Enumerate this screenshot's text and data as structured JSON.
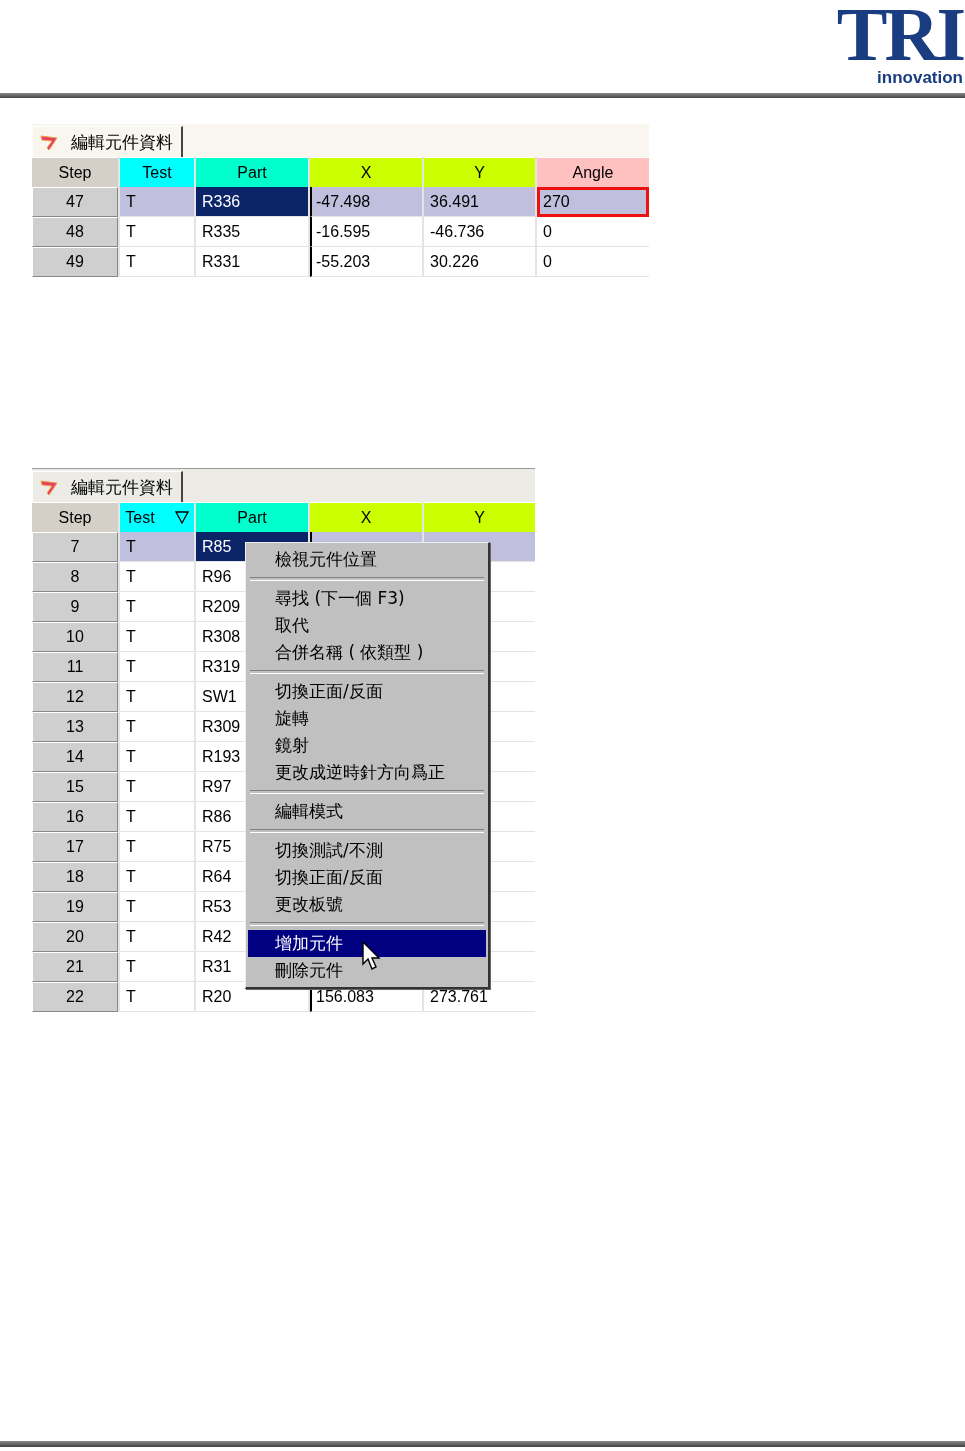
{
  "logo": {
    "title": "TRI",
    "subtitle": "innovation"
  },
  "panels": [
    {
      "tab_title": "編輯元件資料",
      "columns": [
        {
          "label": "Step",
          "color": "#d4d0c8",
          "sort_indicator": false
        },
        {
          "label": "Test",
          "color": "#00ffff",
          "sort_indicator": false
        },
        {
          "label": "Part",
          "color": "#00ffcc",
          "sort_indicator": false
        },
        {
          "label": "X",
          "color": "#ccff00",
          "sort_indicator": false
        },
        {
          "label": "Y",
          "color": "#ccff00",
          "sort_indicator": false
        },
        {
          "label": "Angle",
          "color": "#ffc0c0",
          "sort_indicator": false
        }
      ],
      "rows": [
        {
          "selected": true,
          "cells": [
            {
              "text": "47",
              "selected": false,
              "outlined": false
            },
            {
              "text": "T",
              "selected": false,
              "outlined": false
            },
            {
              "text": "R336",
              "selected": true,
              "outlined": false
            },
            {
              "text": "-47.498",
              "selected": false,
              "outlined": false
            },
            {
              "text": "36.491",
              "selected": false,
              "outlined": false
            },
            {
              "text": "270",
              "selected": false,
              "outlined": true
            }
          ]
        },
        {
          "selected": false,
          "cells": [
            {
              "text": "48",
              "selected": false,
              "outlined": false
            },
            {
              "text": "T",
              "selected": false,
              "outlined": false
            },
            {
              "text": "R335",
              "selected": false,
              "outlined": false
            },
            {
              "text": "-16.595",
              "selected": false,
              "outlined": false
            },
            {
              "text": "-46.736",
              "selected": false,
              "outlined": false
            },
            {
              "text": "0",
              "selected": false,
              "outlined": false
            }
          ]
        },
        {
          "selected": false,
          "cells": [
            {
              "text": "49",
              "selected": false,
              "outlined": false
            },
            {
              "text": "T",
              "selected": false,
              "outlined": false
            },
            {
              "text": "R331",
              "selected": false,
              "outlined": false
            },
            {
              "text": "-55.203",
              "selected": false,
              "outlined": false
            },
            {
              "text": "30.226",
              "selected": false,
              "outlined": false
            },
            {
              "text": "0",
              "selected": false,
              "outlined": false
            }
          ]
        }
      ]
    },
    {
      "tab_title": "編輯元件資料",
      "columns": [
        {
          "label": "Step",
          "color": "#d4d0c8",
          "sort_indicator": false
        },
        {
          "label": "Test",
          "color": "#00ffff",
          "sort_indicator": true
        },
        {
          "label": "Part",
          "color": "#00ffcc",
          "sort_indicator": false
        },
        {
          "label": "X",
          "color": "#ccff00",
          "sort_indicator": false
        },
        {
          "label": "Y",
          "color": "#ccff00",
          "sort_indicator": false
        }
      ],
      "rows": [
        {
          "selected": true,
          "cells": [
            {
              "text": "7",
              "selected": false
            },
            {
              "text": "T",
              "selected": false
            },
            {
              "text": "R85",
              "selected": true
            }
          ]
        },
        {
          "selected": false,
          "cells": [
            {
              "text": "8",
              "selected": false
            },
            {
              "text": "T",
              "selected": false
            },
            {
              "text": "R96",
              "selected": false
            }
          ]
        },
        {
          "selected": false,
          "cells": [
            {
              "text": "9",
              "selected": false
            },
            {
              "text": "T",
              "selected": false
            },
            {
              "text": "R209",
              "selected": false
            }
          ]
        },
        {
          "selected": false,
          "cells": [
            {
              "text": "10",
              "selected": false
            },
            {
              "text": "T",
              "selected": false
            },
            {
              "text": "R308",
              "selected": false
            }
          ]
        },
        {
          "selected": false,
          "cells": [
            {
              "text": "11",
              "selected": false
            },
            {
              "text": "T",
              "selected": false
            },
            {
              "text": "R319",
              "selected": false
            }
          ]
        },
        {
          "selected": false,
          "cells": [
            {
              "text": "12",
              "selected": false
            },
            {
              "text": "T",
              "selected": false
            },
            {
              "text": "SW1",
              "selected": false
            }
          ]
        },
        {
          "selected": false,
          "cells": [
            {
              "text": "13",
              "selected": false
            },
            {
              "text": "T",
              "selected": false
            },
            {
              "text": "R309",
              "selected": false
            }
          ]
        },
        {
          "selected": false,
          "cells": [
            {
              "text": "14",
              "selected": false
            },
            {
              "text": "T",
              "selected": false
            },
            {
              "text": "R193",
              "selected": false
            }
          ]
        },
        {
          "selected": false,
          "cells": [
            {
              "text": "15",
              "selected": false
            },
            {
              "text": "T",
              "selected": false
            },
            {
              "text": "R97",
              "selected": false
            }
          ]
        },
        {
          "selected": false,
          "cells": [
            {
              "text": "16",
              "selected": false
            },
            {
              "text": "T",
              "selected": false
            },
            {
              "text": "R86",
              "selected": false
            }
          ]
        },
        {
          "selected": false,
          "cells": [
            {
              "text": "17",
              "selected": false
            },
            {
              "text": "T",
              "selected": false
            },
            {
              "text": "R75",
              "selected": false
            }
          ]
        },
        {
          "selected": false,
          "cells": [
            {
              "text": "18",
              "selected": false
            },
            {
              "text": "T",
              "selected": false
            },
            {
              "text": "R64",
              "selected": false
            }
          ]
        },
        {
          "selected": false,
          "cells": [
            {
              "text": "19",
              "selected": false
            },
            {
              "text": "T",
              "selected": false
            },
            {
              "text": "R53",
              "selected": false
            }
          ]
        },
        {
          "selected": false,
          "cells": [
            {
              "text": "20",
              "selected": false
            },
            {
              "text": "T",
              "selected": false
            },
            {
              "text": "R42",
              "selected": false
            }
          ]
        },
        {
          "selected": false,
          "cells": [
            {
              "text": "21",
              "selected": false
            },
            {
              "text": "T",
              "selected": false
            },
            {
              "text": "R31",
              "selected": false
            }
          ]
        },
        {
          "selected": false,
          "cells": [
            {
              "text": "22",
              "selected": false
            },
            {
              "text": "T",
              "selected": false
            },
            {
              "text": "R20",
              "selected": false
            },
            {
              "text": "156.083",
              "selected": false
            },
            {
              "text": "273.761",
              "selected": false
            }
          ]
        }
      ],
      "context_menu": {
        "groups": [
          {
            "items": [
              {
                "label": "檢視元件位置",
                "selected": false
              }
            ]
          },
          {
            "items": [
              {
                "label": "尋找 (下一個  F3)",
                "selected": false
              },
              {
                "label": "取代",
                "selected": false
              },
              {
                "label": "合併名稱 ( 依類型 )",
                "selected": false
              }
            ]
          },
          {
            "items": [
              {
                "label": "切換正面/反面",
                "selected": false
              },
              {
                "label": "旋轉",
                "selected": false
              },
              {
                "label": "鏡射",
                "selected": false
              },
              {
                "label": "更改成逆時針方向爲正",
                "selected": false
              }
            ]
          },
          {
            "items": [
              {
                "label": "編輯模式",
                "selected": false
              }
            ]
          },
          {
            "items": [
              {
                "label": "切換測試/不測",
                "selected": false
              },
              {
                "label": "切換正面/反面",
                "selected": false
              },
              {
                "label": "更改板號",
                "selected": false
              }
            ]
          },
          {
            "items": [
              {
                "label": "增加元件",
                "selected": true
              },
              {
                "label": "刪除元件",
                "selected": false
              }
            ]
          }
        ]
      }
    }
  ]
}
